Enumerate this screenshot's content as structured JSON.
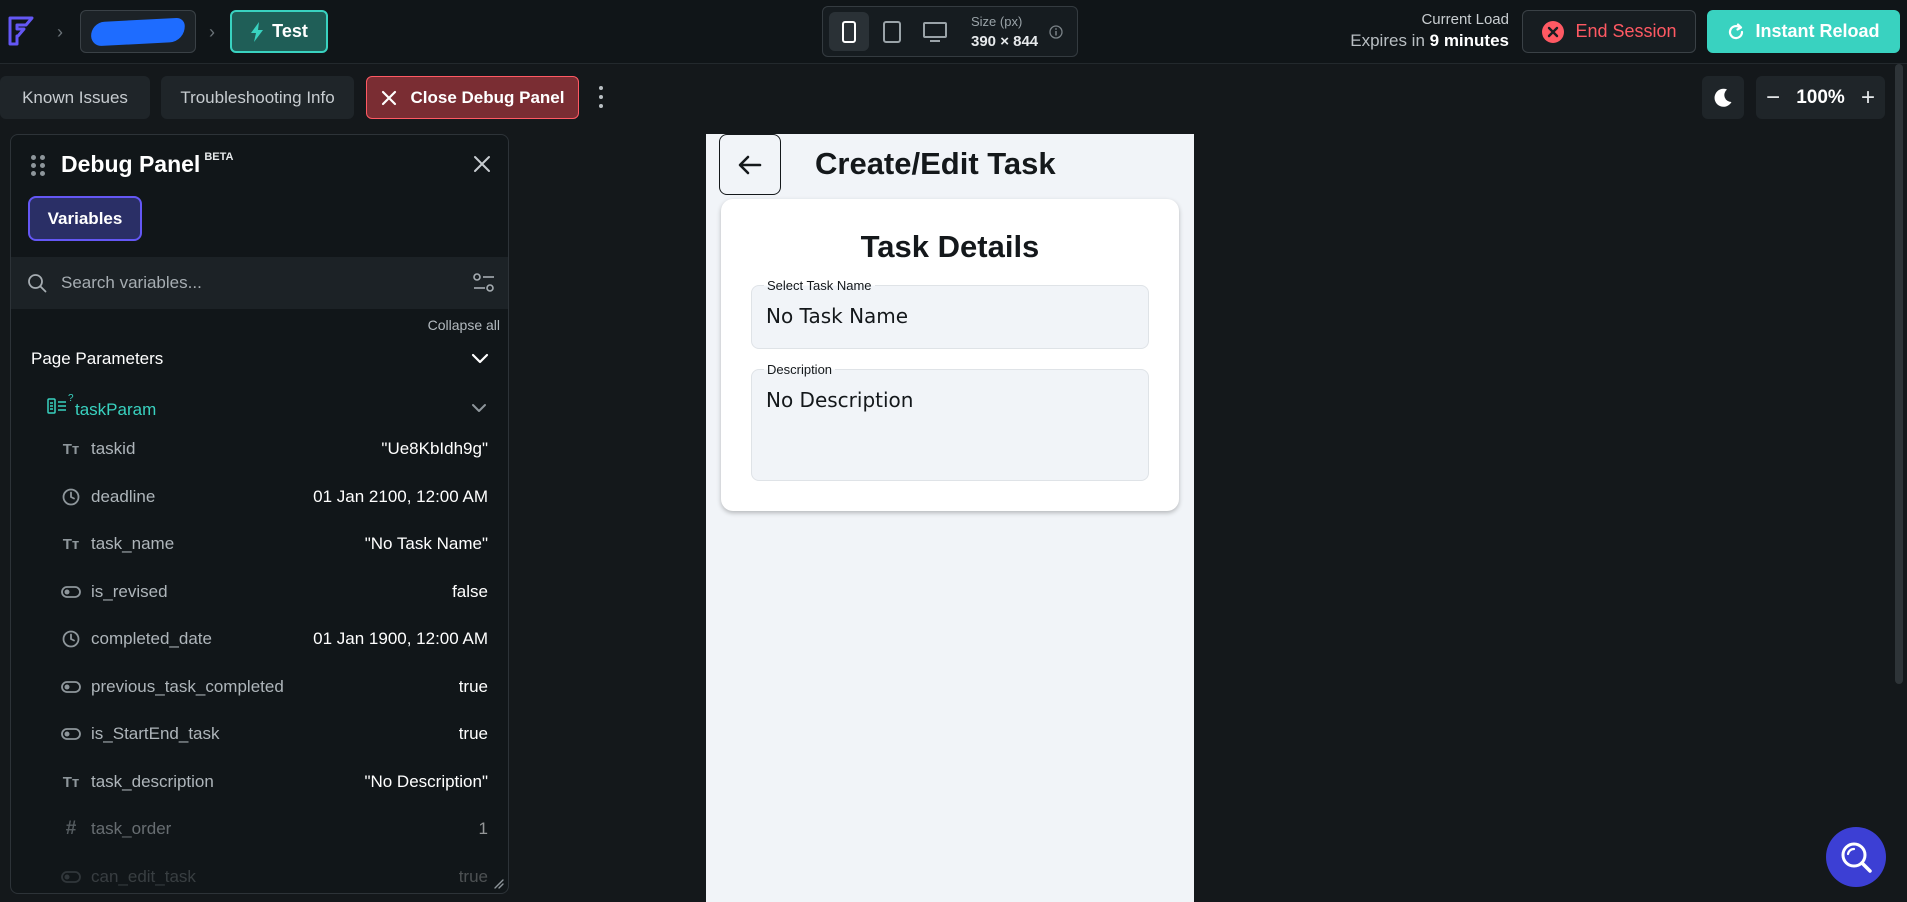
{
  "header": {
    "app_name": "FlutterFlow",
    "breadcrumb_separator": "›",
    "project_name": "",
    "mode_label": "Test",
    "size_label": "Size (px)",
    "size_value": "390 × 844",
    "load_label": "Current Load",
    "expires_prefix": "Expires in",
    "expires_value": "9 minutes",
    "end_session_label": "End Session",
    "instant_reload_label": "Instant Reload"
  },
  "toolbar": {
    "known_issues_label": "Known Issues",
    "troubleshooting_label": "Troubleshooting Info",
    "close_debug_label": "Close Debug Panel",
    "zoom_level": "100%",
    "zoom_minus": "−",
    "zoom_plus": "+"
  },
  "debug_panel": {
    "title": "Debug Panel",
    "badge": "BETA",
    "tab_label": "Variables",
    "search_placeholder": "Search variables...",
    "collapse_all_label": "Collapse all",
    "section_title": "Page Parameters",
    "param_name": "taskParam",
    "param_marker": "?",
    "variables": [
      {
        "type": "text",
        "name": "taskid",
        "value": "\"Ue8KbIdh9g\""
      },
      {
        "type": "datetime",
        "name": "deadline",
        "value": "01 Jan 2100, 12:00 AM"
      },
      {
        "type": "text",
        "name": "task_name",
        "value": "\"No Task Name\""
      },
      {
        "type": "bool",
        "name": "is_revised",
        "value": "false"
      },
      {
        "type": "datetime",
        "name": "completed_date",
        "value": "01 Jan 1900, 12:00 AM"
      },
      {
        "type": "bool",
        "name": "previous_task_completed",
        "value": "true"
      },
      {
        "type": "bool",
        "name": "is_StartEnd_task",
        "value": "true"
      },
      {
        "type": "text",
        "name": "task_description",
        "value": "\"No Description\""
      },
      {
        "type": "int",
        "name": "task_order",
        "value": "1"
      },
      {
        "type": "bool",
        "name": "can_edit_task",
        "value": "true"
      }
    ],
    "type_glyphs": {
      "text": "Tт",
      "int": "#"
    }
  },
  "preview": {
    "page_title": "Create/Edit Task",
    "card_title": "Task Details",
    "task_name_label": "Select Task Name",
    "task_name_value": "No Task Name",
    "description_label": "Description",
    "description_value": "No Description"
  },
  "colors": {
    "accent_teal": "#39d2c0",
    "error_red": "#ff5963",
    "primary_purple": "#6457f5",
    "help_blue": "#3c3fd4"
  }
}
